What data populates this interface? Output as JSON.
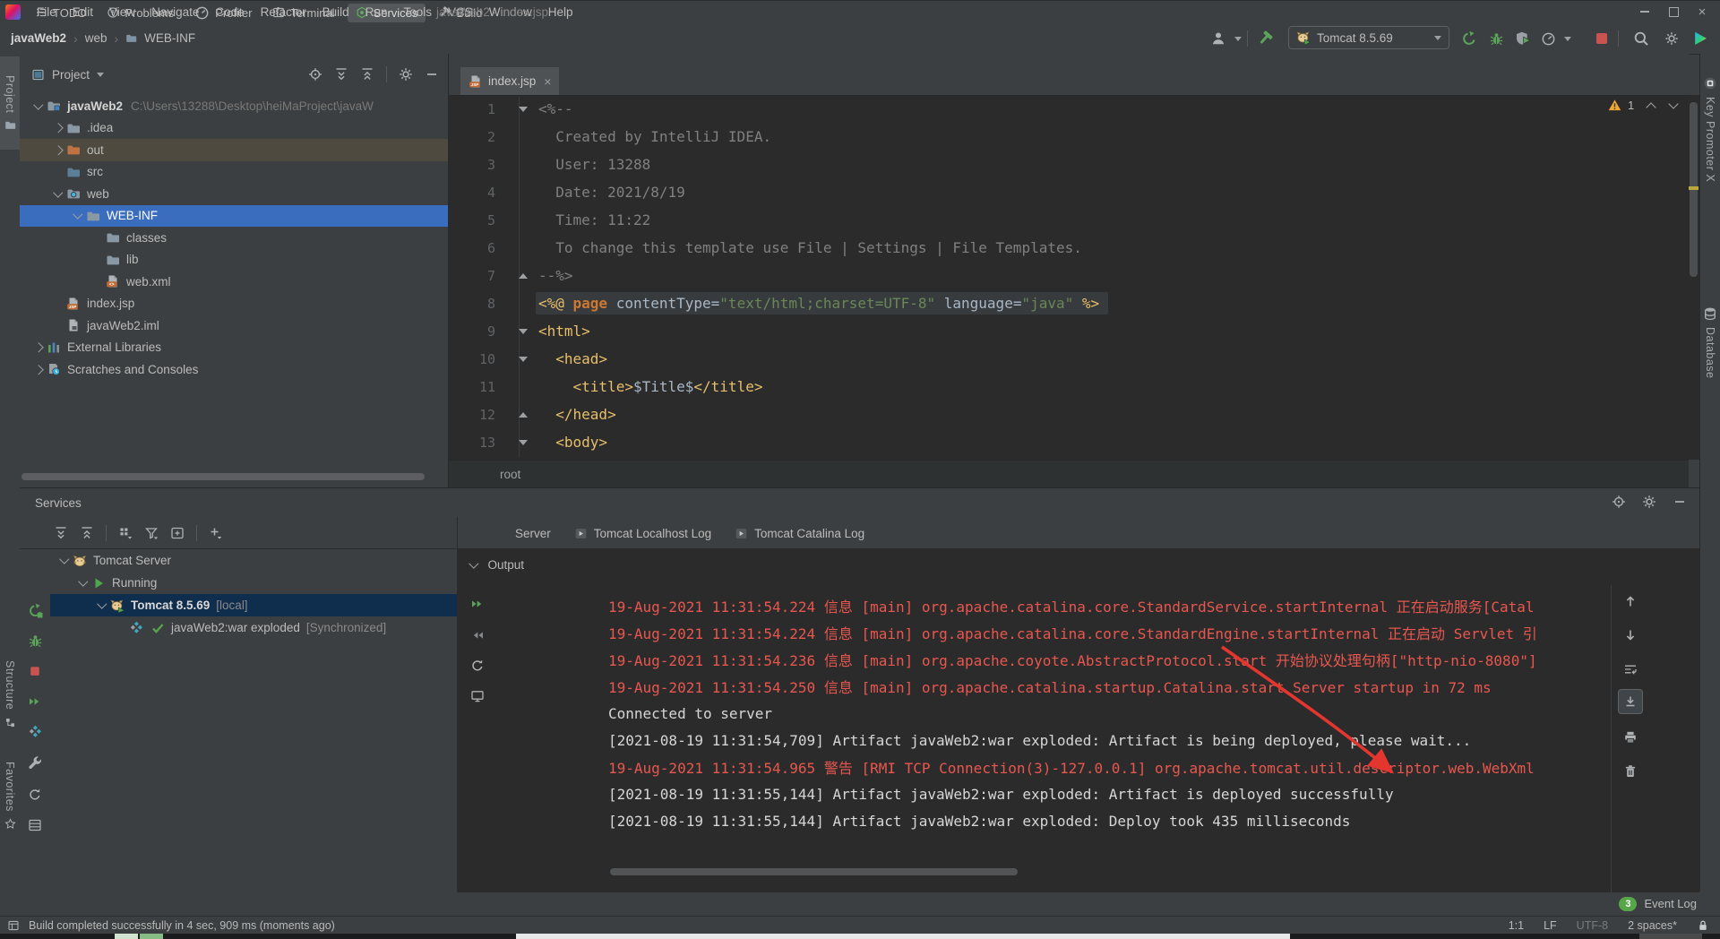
{
  "window": {
    "title": "javaWeb2 - index.jsp"
  },
  "menubar": {
    "items": [
      "File",
      "Edit",
      "View",
      "Navigate",
      "Code",
      "Refactor",
      "Build",
      "Run",
      "Tools",
      "VCS",
      "Window",
      "Help"
    ]
  },
  "navbar": {
    "breadcrumbs": [
      "javaWeb2",
      "web",
      "WEB-INF"
    ],
    "run_config": "Tomcat 8.5.69",
    "icons": [
      "user-icon",
      "build-hammer-icon",
      "run-icon",
      "debug-icon",
      "coverage-icon",
      "profiler-icon",
      "stop-icon",
      "search-icon",
      "settings-icon",
      "plugin-logo-icon"
    ]
  },
  "left_stripe": {
    "tabs": [
      "Project",
      "Structure",
      "Favorites"
    ]
  },
  "right_stripe": {
    "tabs": [
      "Key Promoter X",
      "Database"
    ]
  },
  "project": {
    "title": "Project",
    "tree": [
      {
        "label": "javaWeb2",
        "path": "C:\\Users\\13288\\Desktop\\heiMaProject\\javaW",
        "depth": 0,
        "icon": "folder-project",
        "chevron": "down",
        "bold": true
      },
      {
        "label": ".idea",
        "depth": 1,
        "icon": "folder",
        "chevron": "right"
      },
      {
        "label": "out",
        "depth": 1,
        "icon": "folder-excluded",
        "chevron": "right",
        "highlight": "olive"
      },
      {
        "label": "src",
        "depth": 1,
        "icon": "folder-source"
      },
      {
        "label": "web",
        "depth": 1,
        "icon": "folder-web",
        "chevron": "down"
      },
      {
        "label": "WEB-INF",
        "depth": 2,
        "icon": "folder",
        "chevron": "down",
        "selected": true
      },
      {
        "label": "classes",
        "depth": 3,
        "icon": "folder"
      },
      {
        "label": "lib",
        "depth": 3,
        "icon": "folder"
      },
      {
        "label": "web.xml",
        "depth": 3,
        "icon": "file-xml"
      },
      {
        "label": "index.jsp",
        "depth": 1,
        "icon": "file-jsp"
      },
      {
        "label": "javaWeb2.iml",
        "depth": 1,
        "icon": "file-iml"
      },
      {
        "label": "External Libraries",
        "depth": 0,
        "icon": "libraries",
        "chevron": "right"
      },
      {
        "label": "Scratches and Consoles",
        "depth": 0,
        "icon": "scratches",
        "chevron": "right"
      }
    ]
  },
  "editor": {
    "tab": {
      "label": "index.jsp"
    },
    "inspections": {
      "warnings": "1"
    },
    "breadcrumb": "root",
    "lines": [
      {
        "n": "1",
        "fold": "down",
        "seg": [
          {
            "t": "<%--",
            "c": "cmt"
          }
        ]
      },
      {
        "n": "2",
        "seg": [
          {
            "t": "  Created by IntelliJ IDEA.",
            "c": "cmt"
          }
        ]
      },
      {
        "n": "3",
        "seg": [
          {
            "t": "  User: 13288",
            "c": "cmt"
          }
        ]
      },
      {
        "n": "4",
        "seg": [
          {
            "t": "  Date: 2021/8/19",
            "c": "cmt"
          }
        ]
      },
      {
        "n": "5",
        "seg": [
          {
            "t": "  Time: 11:22",
            "c": "cmt"
          }
        ]
      },
      {
        "n": "6",
        "seg": [
          {
            "t": "  To change this template use File | Settings | File Templates.",
            "c": "cmt"
          }
        ]
      },
      {
        "n": "7",
        "fold": "up",
        "seg": [
          {
            "t": "--%>",
            "c": "cmt"
          }
        ]
      },
      {
        "n": "8",
        "band": true,
        "seg": [
          {
            "t": "<%@ ",
            "c": "tag"
          },
          {
            "t": "page",
            "c": "kw"
          },
          {
            "t": " contentType",
            "c": "attr"
          },
          {
            "t": "=",
            "c": "plain"
          },
          {
            "t": "\"text/html;charset=UTF-8\"",
            "c": "str"
          },
          {
            "t": " language",
            "c": "attr"
          },
          {
            "t": "=",
            "c": "plain"
          },
          {
            "t": "\"java\"",
            "c": "str"
          },
          {
            "t": " %>",
            "c": "tag"
          }
        ]
      },
      {
        "n": "9",
        "fold": "down",
        "seg": [
          {
            "t": "<html>",
            "c": "tag"
          }
        ]
      },
      {
        "n": "10",
        "fold": "down",
        "seg": [
          {
            "t": "  <head>",
            "c": "tag"
          }
        ]
      },
      {
        "n": "11",
        "seg": [
          {
            "t": "    <title>",
            "c": "tag"
          },
          {
            "t": "$Title$",
            "c": "var"
          },
          {
            "t": "</title>",
            "c": "tag"
          }
        ]
      },
      {
        "n": "12",
        "fold": "up",
        "seg": [
          {
            "t": "  </head>",
            "c": "tag"
          }
        ]
      },
      {
        "n": "13",
        "fold": "down",
        "seg": [
          {
            "t": "  <body>",
            "c": "tag"
          }
        ]
      }
    ]
  },
  "services": {
    "title": "Services",
    "tree": [
      {
        "label": "Tomcat Server",
        "depth": 0,
        "icon": "tomcat",
        "chevron": "down"
      },
      {
        "label": "Running",
        "depth": 1,
        "icon": "play",
        "chevron": "down"
      },
      {
        "label": "Tomcat 8.5.69",
        "extra": "[local]",
        "depth": 2,
        "icon": "tomcat-run",
        "chevron": "down",
        "bold": true,
        "selected": true
      },
      {
        "label": "javaWeb2:war exploded",
        "extra": "[Synchronized]",
        "depth": 3,
        "icon": "artifact-ok"
      }
    ],
    "console": {
      "tabs": [
        {
          "label": "Server"
        },
        {
          "label": "Tomcat Localhost Log",
          "icon": "log-tab-icon"
        },
        {
          "label": "Tomcat Catalina Log",
          "icon": "log-tab-icon"
        }
      ],
      "section": "Output",
      "lines": [
        {
          "t": "19-Aug-2021 11:31:54.224 信息 [main] org.apache.catalina.core.StandardService.startInternal 正在启动服务[Catal",
          "c": "cred"
        },
        {
          "t": "19-Aug-2021 11:31:54.224 信息 [main] org.apache.catalina.core.StandardEngine.startInternal 正在启动 Servlet 引",
          "c": "cred"
        },
        {
          "t": "19-Aug-2021 11:31:54.236 信息 [main] org.apache.coyote.AbstractProtocol.start 开始协议处理句柄[\"http-nio-8080\"]",
          "c": "cred"
        },
        {
          "t": "19-Aug-2021 11:31:54.250 信息 [main] org.apache.catalina.startup.Catalina.start Server startup in 72 ms",
          "c": "cred"
        },
        {
          "t": "Connected to server",
          "c": "cwhite"
        },
        {
          "t": "[2021-08-19 11:31:54,709] Artifact javaWeb2:war exploded: Artifact is being deployed, please wait...",
          "c": "cwhite"
        },
        {
          "t": "19-Aug-2021 11:31:54.965 警告 [RMI TCP Connection(3)-127.0.0.1] org.apache.tomcat.util.descriptor.web.WebXml",
          "c": "cred"
        },
        {
          "t": "[2021-08-19 11:31:55,144] Artifact javaWeb2:war exploded: Artifact is deployed successfully",
          "c": "cwhite"
        },
        {
          "t": "[2021-08-19 11:31:55,144] Artifact javaWeb2:war exploded: Deploy took 435 milliseconds",
          "c": "cwhite"
        }
      ]
    }
  },
  "bottom_bar": {
    "tabs": [
      {
        "label": "TODO",
        "icon": "todo-icon"
      },
      {
        "label": "Problems",
        "icon": "problems-icon"
      },
      {
        "label": "Profiler",
        "icon": "profiler-gauge-icon"
      },
      {
        "label": "Terminal",
        "icon": "terminal-icon"
      },
      {
        "label": "Services",
        "icon": "services-icon",
        "selected": true
      },
      {
        "label": "Build",
        "icon": "build-hammer-icon"
      }
    ],
    "event_log": {
      "label": "Event Log",
      "badge": "3"
    }
  },
  "status_bar": {
    "message": "Build completed successfully in 4 sec, 909 ms (moments ago)",
    "caret": "1:1",
    "line_ending": "LF",
    "encoding": "UTF-8",
    "indent": "2 spaces*"
  },
  "colors": {
    "console_error": "#E8574F",
    "console_text": "#D6D6D6",
    "selection_focused": "#3A6DBE",
    "selection_unfocused": "#0F2D4D",
    "excluded_row": "#4E4A40",
    "warning": "#F0A732",
    "annotation_arrow": "#E3362E",
    "badge_green": "#57A64A"
  }
}
